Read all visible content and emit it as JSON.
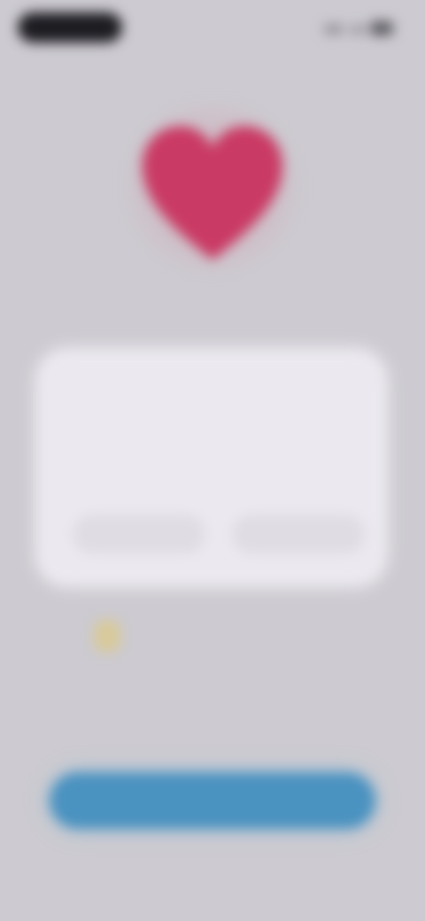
{
  "status_bar": {
    "time": "",
    "icons": [
      "signal-icon",
      "wifi-icon",
      "battery-icon"
    ]
  },
  "header": {
    "link_label": ""
  },
  "hero": {
    "icon": "heart-icon",
    "icon_color": "#c93a64",
    "headline": ""
  },
  "card": {
    "title": "",
    "body": "",
    "buttons": [
      {
        "label": ""
      },
      {
        "label": ""
      }
    ]
  },
  "tip": {
    "icon": "lightbulb-icon",
    "text": ""
  },
  "footer": {
    "primary_button_label": ""
  }
}
